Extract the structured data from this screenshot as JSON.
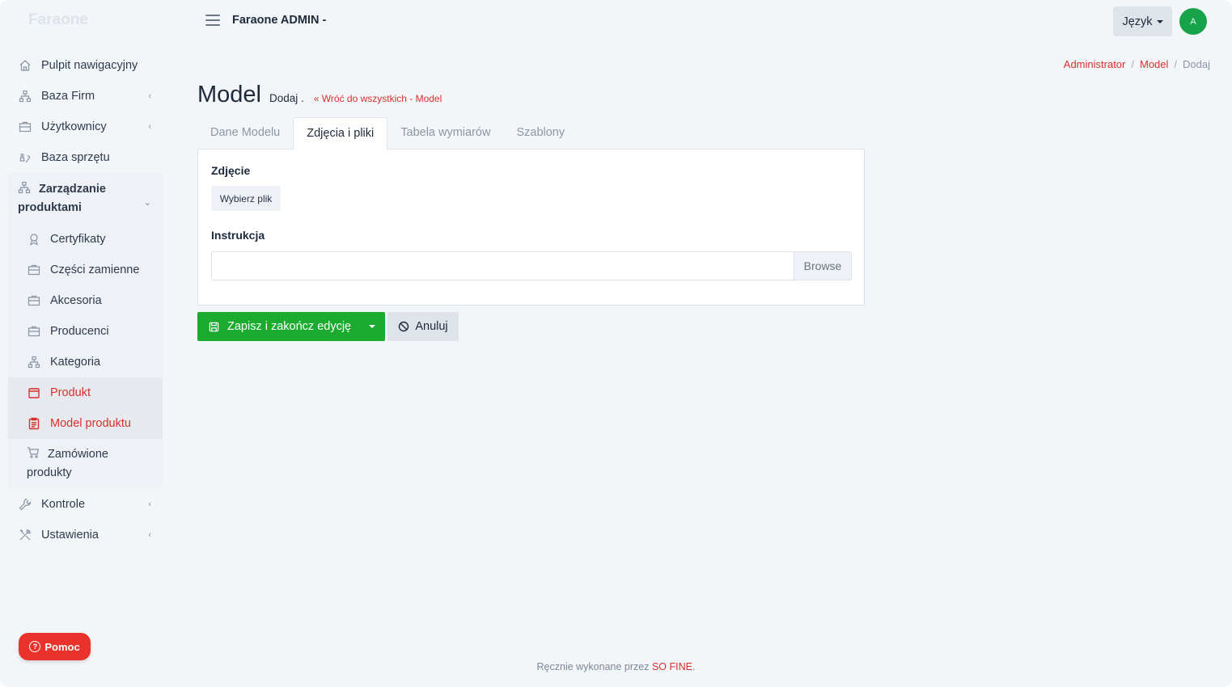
{
  "brand": "Faraone",
  "header": {
    "title": "Faraone ADMIN -",
    "language_label": "Język",
    "avatar_initial": "A"
  },
  "sidebar": {
    "items": [
      {
        "label": "Pulpit nawigacyjny",
        "icon": "home-icon"
      },
      {
        "label": "Baza Firm",
        "icon": "sitemap-icon"
      },
      {
        "label": "Użytkownicy",
        "icon": "briefcase-icon"
      },
      {
        "label": "Baza sprzętu",
        "icon": "equipment-icon"
      },
      {
        "label": "Kontrole",
        "icon": "wrench-icon"
      },
      {
        "label": "Ustawienia",
        "icon": "tools-icon"
      }
    ],
    "group": {
      "label": "Zarządzanie produktami",
      "icon": "sitemap-icon",
      "sub_items": [
        {
          "label": "Certyfikaty",
          "icon": "award-icon"
        },
        {
          "label": "Części zamienne",
          "icon": "briefcase-icon"
        },
        {
          "label": "Akcesoria",
          "icon": "briefcase-icon"
        },
        {
          "label": "Producenci",
          "icon": "briefcase-icon"
        },
        {
          "label": "Kategoria",
          "icon": "sitemap-icon"
        },
        {
          "label": "Produkt",
          "icon": "box-icon"
        },
        {
          "label": "Model produktu",
          "icon": "clipboard-icon"
        },
        {
          "label": "Zamówione produkty",
          "icon": "cart-icon"
        }
      ]
    },
    "help_label": "Pomoc"
  },
  "breadcrumb": [
    "Administrator",
    "Model",
    "Dodaj"
  ],
  "page": {
    "title": "Model",
    "subtitle": "Dodaj .",
    "back_link": "« Wróć do wszystkich - Model"
  },
  "tabs": [
    "Dane Modelu",
    "Zdjęcia i pliki",
    "Tabela wymiarów",
    "Szablony"
  ],
  "form": {
    "photo_label": "Zdjęcie",
    "choose_file": "Wybierz plik",
    "instruction_label": "Instrukcja",
    "instruction_value": "",
    "browse_label": "Browse"
  },
  "actions": {
    "save_label": "Zapisz i zakończ edycję",
    "cancel_label": "Anuluj"
  },
  "footer": {
    "text": "Ręcznie wykonane przez",
    "brand": "SO FINE",
    "suffix": "."
  },
  "colors": {
    "accent": "#d9302c",
    "success": "#1aab2f",
    "background": "#f3f6f9"
  }
}
